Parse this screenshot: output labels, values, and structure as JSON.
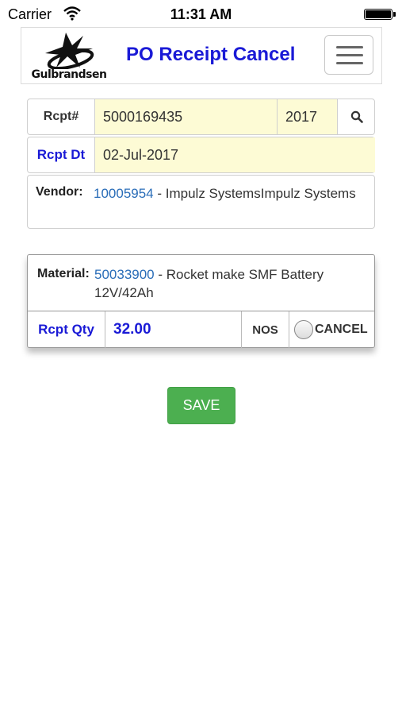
{
  "status_bar": {
    "carrier": "Carrier",
    "time": "11:31 AM"
  },
  "header": {
    "logo_text": "Gulbrandsen",
    "title": "PO Receipt Cancel"
  },
  "receipt": {
    "rcpt_label": "Rcpt#",
    "rcpt_number": "5000169435",
    "rcpt_year": "2017",
    "date_label": "Rcpt Dt",
    "date_value": "02-Jul-2017",
    "vendor_label": "Vendor:",
    "vendor_code": "10005954",
    "vendor_name": " - Impulz SystemsImpulz Systems"
  },
  "item": {
    "material_label": "Material:",
    "material_code": "50033900",
    "material_desc": " - Rocket make SMF Battery 12V/42Ah",
    "qty_label": "Rcpt Qty",
    "qty_value": "32.00",
    "uom": "NOS",
    "cancel_label": "CANCEL"
  },
  "save_label": "SAVE",
  "icons": {
    "search": "search-icon",
    "menu": "hamburger-menu-icon",
    "wifi": "wifi-icon",
    "battery": "battery-icon"
  },
  "colors": {
    "title_blue": "#1a1ad6",
    "link_blue": "#2a6db8",
    "input_bg": "#fdfbd5",
    "save_green": "#4caf50"
  }
}
